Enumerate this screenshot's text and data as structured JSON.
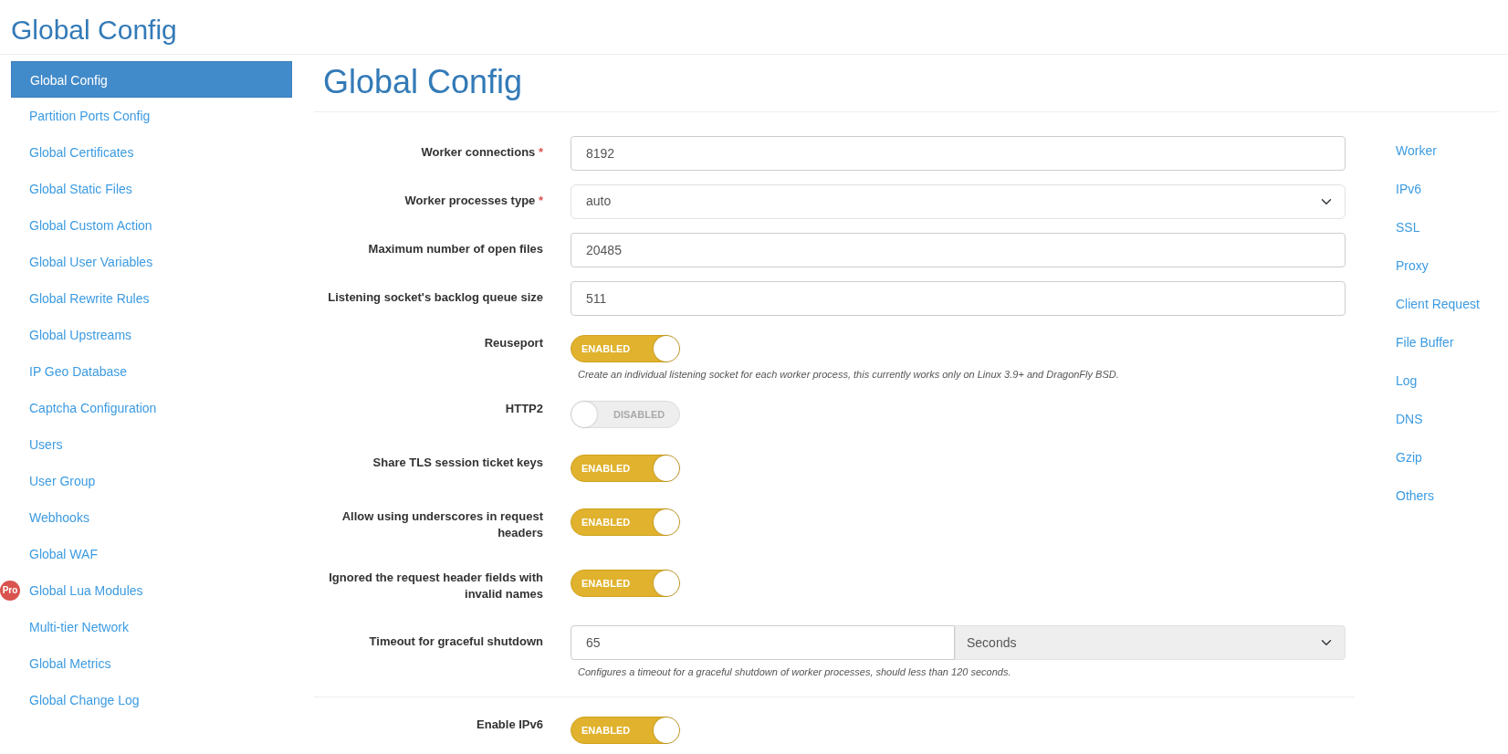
{
  "header": {
    "title": "Global Config"
  },
  "sidebar": {
    "items": [
      {
        "label": "Global Config",
        "selected": true
      },
      {
        "label": "Partition Ports Config",
        "selected": false
      },
      {
        "label": "Global Certificates",
        "selected": false
      },
      {
        "label": "Global Static Files",
        "selected": false
      },
      {
        "label": "Global Custom Action",
        "selected": false
      },
      {
        "label": "Global User Variables",
        "selected": false
      },
      {
        "label": "Global Rewrite Rules",
        "selected": false
      },
      {
        "label": "Global Upstreams",
        "selected": false
      },
      {
        "label": "IP Geo Database",
        "selected": false
      },
      {
        "label": "Captcha Configuration",
        "selected": false
      },
      {
        "label": "Users",
        "selected": false
      },
      {
        "label": "User Group",
        "selected": false
      },
      {
        "label": "Webhooks",
        "selected": false
      },
      {
        "label": "Global WAF",
        "selected": false
      },
      {
        "label": "Global Lua Modules",
        "selected": false,
        "badge": "Pro"
      },
      {
        "label": "Multi-tier Network",
        "selected": false
      },
      {
        "label": "Global Metrics",
        "selected": false
      },
      {
        "label": "Global Change Log",
        "selected": false
      }
    ]
  },
  "main": {
    "title": "Global Config",
    "sections": [
      {
        "fields": [
          {
            "kind": "text",
            "label": "Worker connections",
            "required_mark": "*",
            "value": "8192"
          },
          {
            "kind": "select",
            "label": "Worker processes type",
            "required_mark": "*",
            "value": "auto"
          },
          {
            "kind": "text",
            "label": "Maximum number of open files",
            "value": "20485"
          },
          {
            "kind": "text",
            "label": "Listening socket's backlog queue size",
            "value": "511"
          },
          {
            "kind": "toggle",
            "label": "Reuseport",
            "on": true,
            "state_text": "ENABLED",
            "help": "Create an individual listening socket for each worker process, this currently works only on Linux 3.9+ and DragonFly BSD."
          },
          {
            "kind": "toggle",
            "label": "HTTP2",
            "on": false,
            "state_text": "DISABLED"
          },
          {
            "kind": "toggle",
            "label": "Share TLS session ticket keys",
            "on": true,
            "state_text": "ENABLED"
          },
          {
            "kind": "toggle",
            "label": "Allow using underscores in request headers",
            "on": true,
            "state_text": "ENABLED"
          },
          {
            "kind": "toggle",
            "label": "Ignored the request header fields with invalid names",
            "on": true,
            "state_text": "ENABLED"
          },
          {
            "kind": "unit",
            "label": "Timeout for graceful shutdown",
            "value": "65",
            "unit": "Seconds",
            "help": "Configures a timeout for a graceful shutdown of worker processes, should less than 120 seconds."
          }
        ]
      },
      {
        "fields": [
          {
            "kind": "toggle",
            "label": "Enable IPv6",
            "on": true,
            "state_text": "ENABLED"
          }
        ]
      }
    ]
  },
  "section_nav": [
    "Worker",
    "IPv6",
    "SSL",
    "Proxy",
    "Client Request",
    "File Buffer",
    "Log",
    "DNS",
    "Gzip",
    "Others"
  ]
}
